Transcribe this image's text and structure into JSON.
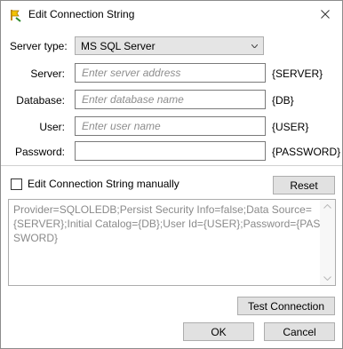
{
  "window": {
    "title": "Edit Connection String"
  },
  "server_type": {
    "label": "Server type:",
    "value": "MS SQL Server"
  },
  "fields": [
    {
      "label": "Server:",
      "placeholder": "Enter server address",
      "value": "",
      "token": "{SERVER}"
    },
    {
      "label": "Database:",
      "placeholder": "Enter database name",
      "value": "",
      "token": "{DB}"
    },
    {
      "label": "User:",
      "placeholder": "Enter user name",
      "value": "",
      "token": "{USER}"
    },
    {
      "label": "Password:",
      "placeholder": "",
      "value": "",
      "token": "{PASSWORD}"
    }
  ],
  "manual": {
    "label": "Edit Connection String manually",
    "checked": false
  },
  "buttons": {
    "reset": "Reset",
    "test": "Test Connection",
    "ok": "OK",
    "cancel": "Cancel"
  },
  "connection_string": "Provider=SQLOLEDB;Persist Security Info=false;Data Source={SERVER};Initial Catalog={DB};User Id={USER};Password={PASSWORD}",
  "icons": {
    "app": "plug-icon",
    "close": "close-icon",
    "dropdown": "chevron-down-icon"
  },
  "colors": {
    "button_face": "#e1e1e1",
    "border": "#adadad",
    "memo_text": "#8a8a8a"
  }
}
